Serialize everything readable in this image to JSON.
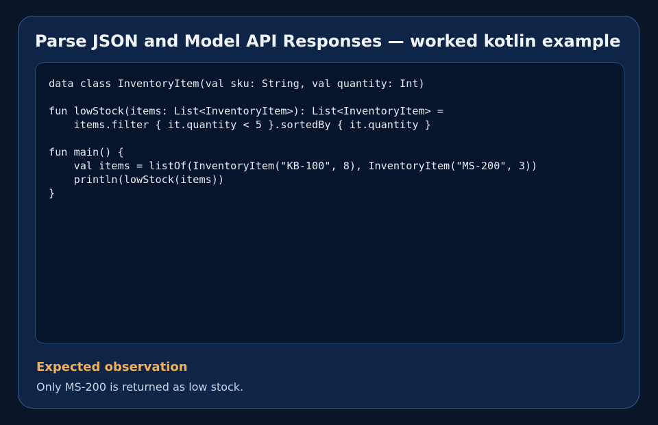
{
  "title": "Parse JSON and Model API Responses — worked kotlin example",
  "code": "data class InventoryItem(val sku: String, val quantity: Int)\n\nfun lowStock(items: List<InventoryItem>): List<InventoryItem> =\n    items.filter { it.quantity < 5 }.sortedBy { it.quantity }\n\nfun main() {\n    val items = listOf(InventoryItem(\"KB-100\", 8), InventoryItem(\"MS-200\", 3))\n    println(lowStock(items))\n}",
  "observation": {
    "heading": "Expected observation",
    "text": "Only MS-200 is returned as low stock."
  },
  "colors": {
    "background": "#0a1628",
    "card": "#0f2547",
    "code_panel": "#06152b",
    "accent": "#f0b15a"
  }
}
